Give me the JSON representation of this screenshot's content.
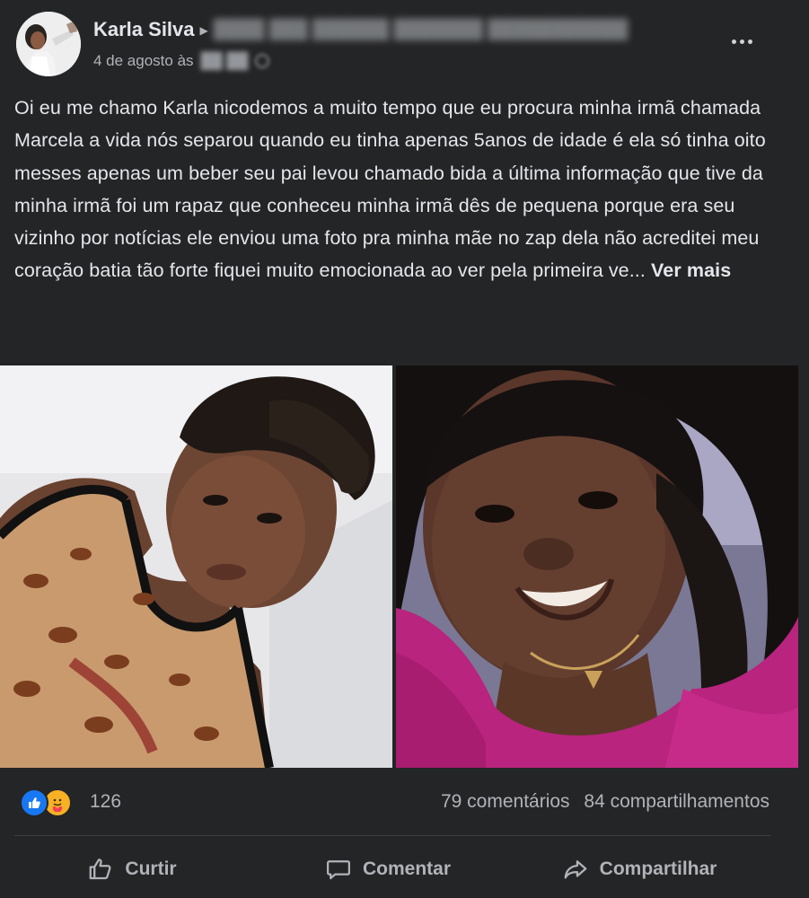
{
  "post": {
    "author": "Karla Silva",
    "date": "4 de agosto às",
    "text": "Oi eu me chamo Karla nicodemos a muito tempo que eu procura minha irmã chamada Marcela a vida nós separou quando eu tinha apenas 5anos de idade é ela só tinha oito messes apenas um beber seu pai levou chamado bida a última informação que tive da minha irmã foi um rapaz que conheceu minha irmã dês de pequena porque era seu vizinho por notícias ele enviou uma foto pra minha mãe no zap dela não acreditei meu coração batia tão forte fiquei muito emocionada ao ver pela primeira ve...",
    "see_more": "Ver mais"
  },
  "reactions": {
    "icons": [
      "like-icon",
      "care-icon"
    ],
    "count": "126",
    "comments": "79 comentários",
    "shares": "84 compartilhamentos"
  },
  "actions": {
    "like": "Curtir",
    "comment": "Comentar",
    "share": "Compartilhar"
  },
  "colors": {
    "background": "#242526",
    "text": "#e4e6eb",
    "secondary": "#b0b3b8",
    "like_blue": "#1877f2",
    "care_yellow": "#f7b125"
  }
}
